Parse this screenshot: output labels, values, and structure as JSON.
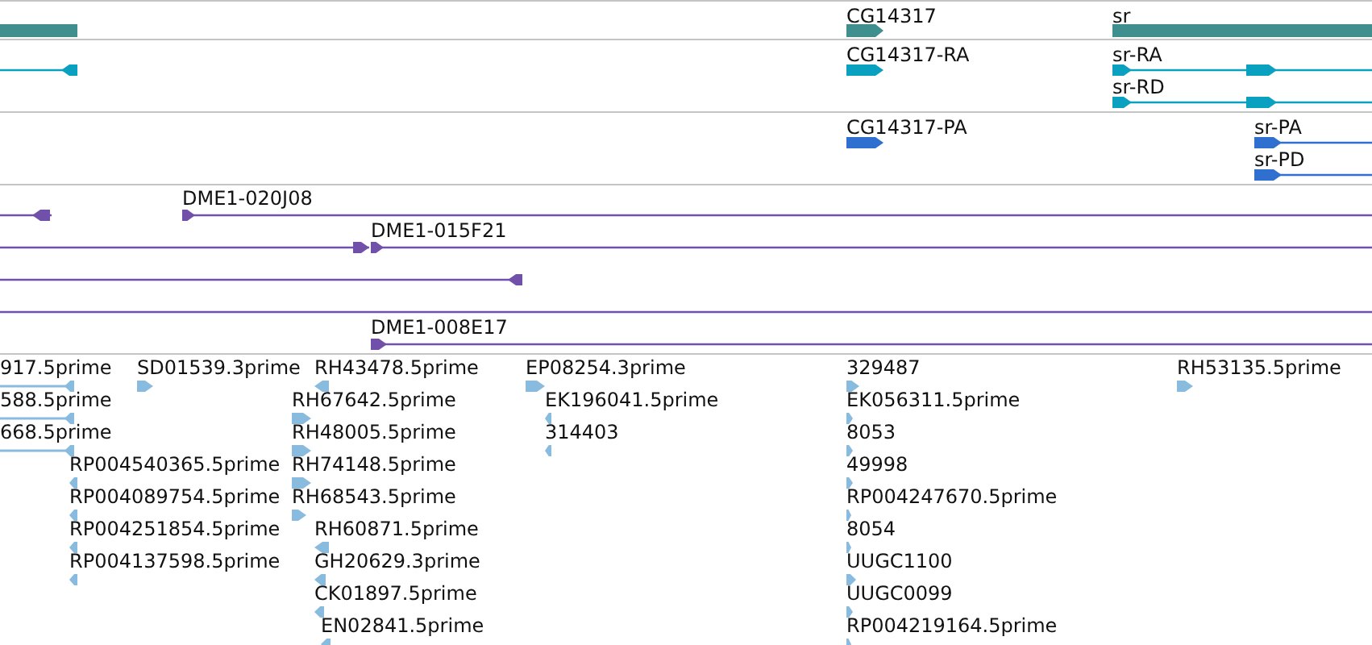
{
  "tracks": [
    {
      "kind": "gene",
      "features": [
        {
          "kind": "plain"
        },
        {
          "label": "CG14317",
          "kind": "forward"
        },
        {
          "label": "sr",
          "kind": "plain"
        }
      ]
    },
    {
      "kind": "transcript",
      "features": [
        {
          "kind": "reverse"
        },
        {
          "label": "CG14317-RA",
          "kind": "forward"
        },
        {
          "label": "sr-RA",
          "kind": "forward"
        },
        {
          "label": "sr-RD",
          "kind": "forward"
        }
      ]
    },
    {
      "kind": "protein",
      "features": [
        {
          "label": "CG14317-PA",
          "kind": "forward"
        },
        {
          "label": "sr-PA",
          "kind": "forward"
        },
        {
          "label": "sr-PD",
          "kind": "forward"
        }
      ]
    },
    {
      "kind": "clone",
      "features": [
        {
          "kind": "reverse"
        },
        {
          "label": "DME1-020J08",
          "kind": "forward"
        },
        {
          "kind": "forward"
        },
        {
          "label": "DME1-015F21",
          "kind": "forward"
        },
        {
          "kind": "reverse"
        },
        {
          "kind": "plain"
        },
        {
          "label": "DME1-008E17",
          "kind": "forward"
        }
      ]
    },
    {
      "kind": "est",
      "features": [
        {
          "label": "917.5prime",
          "kind": "reverse"
        },
        {
          "label": "588.5prime",
          "kind": "reverse"
        },
        {
          "label": "668.5prime",
          "kind": "reverse"
        },
        {
          "label": "SD01539.3prime",
          "kind": "forward"
        },
        {
          "label": "RH43478.5prime",
          "kind": "reverse"
        },
        {
          "label": "RH67642.5prime",
          "kind": "forward"
        },
        {
          "label": "RH48005.5prime",
          "kind": "forward"
        },
        {
          "label": "RH74148.5prime",
          "kind": "forward"
        },
        {
          "label": "RH68543.5prime",
          "kind": "forward"
        },
        {
          "label": "RP004540365.5prime",
          "kind": "reverse"
        },
        {
          "label": "RP004089754.5prime",
          "kind": "reverse"
        },
        {
          "label": "RP004251854.5prime",
          "kind": "reverse"
        },
        {
          "label": "RP004137598.5prime",
          "kind": "reverse"
        },
        {
          "label": "RH60871.5prime",
          "kind": "reverse"
        },
        {
          "label": "GH20629.3prime",
          "kind": "reverse"
        },
        {
          "label": "CK01897.5prime",
          "kind": "reverse"
        },
        {
          "label": "EN02841.5prime",
          "kind": "reverse"
        },
        {
          "label": "EP08254.3prime",
          "kind": "forward"
        },
        {
          "label": "EK196041.5prime",
          "kind": "reverse"
        },
        {
          "label": "314403",
          "kind": "reverse"
        },
        {
          "label": "329487",
          "kind": "forward"
        },
        {
          "label": "EK056311.5prime",
          "kind": "forward"
        },
        {
          "label": "8053",
          "kind": "forward"
        },
        {
          "label": "49998",
          "kind": "forward"
        },
        {
          "label": "RP004247670.5prime",
          "kind": "forward"
        },
        {
          "label": "8054",
          "kind": "forward"
        },
        {
          "label": "UUGC1100",
          "kind": "forward"
        },
        {
          "label": "UUGC0099",
          "kind": "forward"
        },
        {
          "label": "RP004219164.5prime",
          "kind": "forward"
        },
        {
          "label": "RH53135.5prime",
          "kind": "forward"
        }
      ]
    }
  ]
}
